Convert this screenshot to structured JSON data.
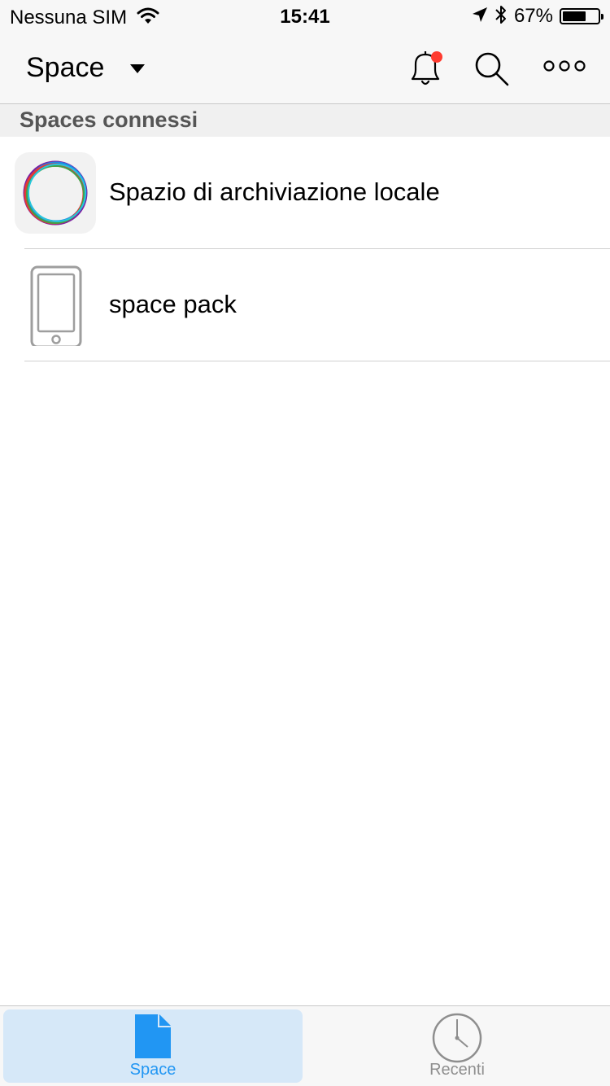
{
  "status_bar": {
    "carrier": "Nessuna SIM",
    "time": "15:41",
    "battery_percent": "67%",
    "battery_level": 0.67
  },
  "navbar": {
    "title": "Space",
    "notification_dot_color": "#ff3b30"
  },
  "section": {
    "title": "Spaces connessi"
  },
  "list": {
    "items": [
      {
        "label": "Spazio di archiviazione locale",
        "icon": "storage-ring-icon"
      },
      {
        "label": "space pack",
        "icon": "phone-device-icon"
      }
    ]
  },
  "tabbar": {
    "tabs": [
      {
        "label": "Space",
        "icon": "document-icon",
        "selected": true
      },
      {
        "label": "Recenti",
        "icon": "clock-icon",
        "selected": false
      }
    ],
    "accent_color": "#2196f3"
  }
}
